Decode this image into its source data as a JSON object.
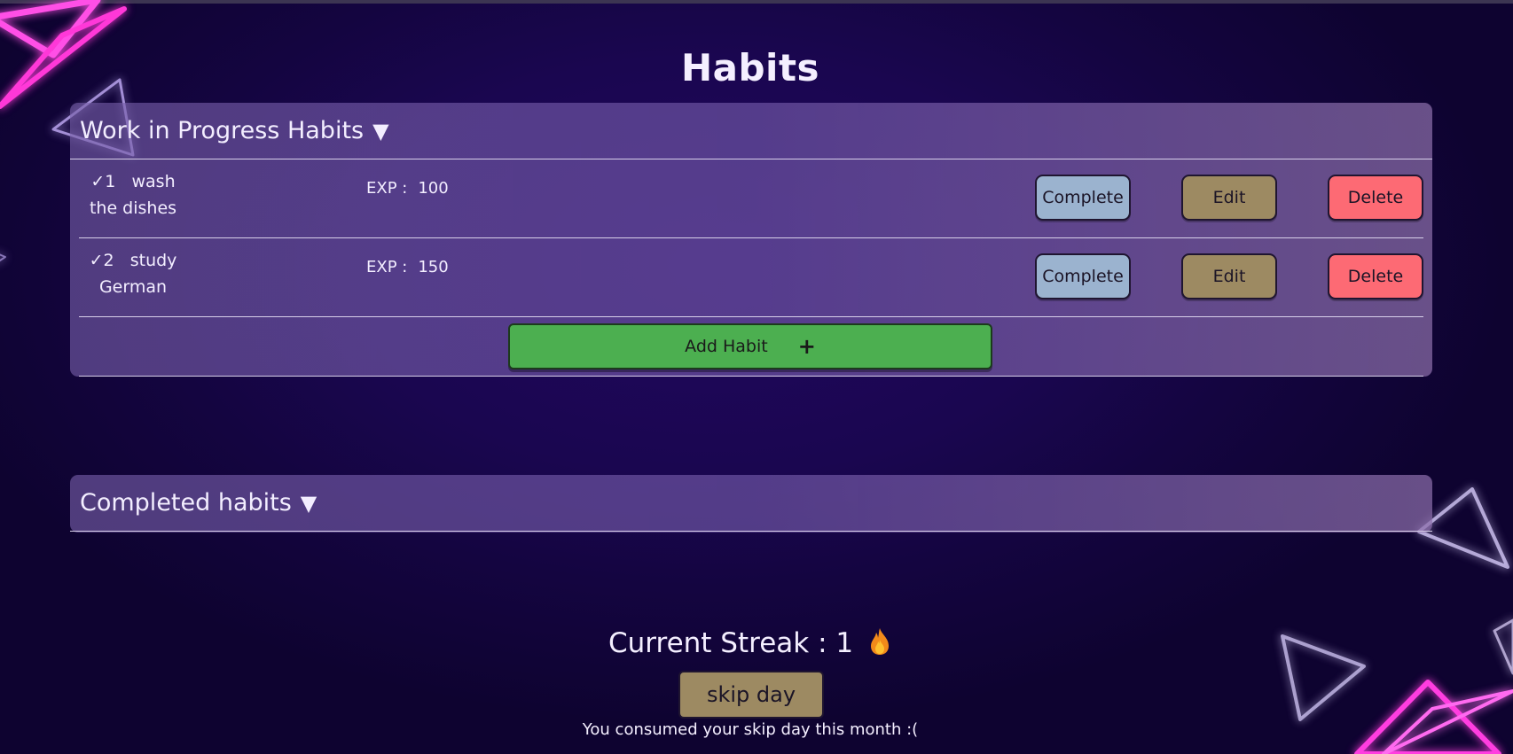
{
  "page": {
    "title": "Habits"
  },
  "wip_section": {
    "title": "Work in Progress Habits",
    "caret": "▼",
    "habits": [
      {
        "check": "✓",
        "number": "1",
        "name_line1": "wash",
        "name_line2": "the dishes",
        "exp_label": "EXP :",
        "exp_value": "100"
      },
      {
        "check": "✓",
        "number": "2",
        "name_line1": "study",
        "name_line2": "German",
        "exp_label": "EXP :",
        "exp_value": "150"
      }
    ],
    "actions": {
      "complete": "Complete",
      "edit": "Edit",
      "delete": "Delete"
    },
    "add_habit": {
      "label": "Add Habit",
      "icon": "+"
    }
  },
  "completed_section": {
    "title": "Completed habits",
    "caret": "▼"
  },
  "streak": {
    "label": "Current Streak : 1",
    "icon": "fire-icon"
  },
  "skip": {
    "button_label": "skip day",
    "note": "You consumed your skip day this month :("
  },
  "colors": {
    "complete_button": "#9bb3cf",
    "edit_button": "#9d8a62",
    "delete_button": "#fd6a74",
    "add_button": "#4caf50",
    "neon_accent": "#ff2bd6"
  }
}
